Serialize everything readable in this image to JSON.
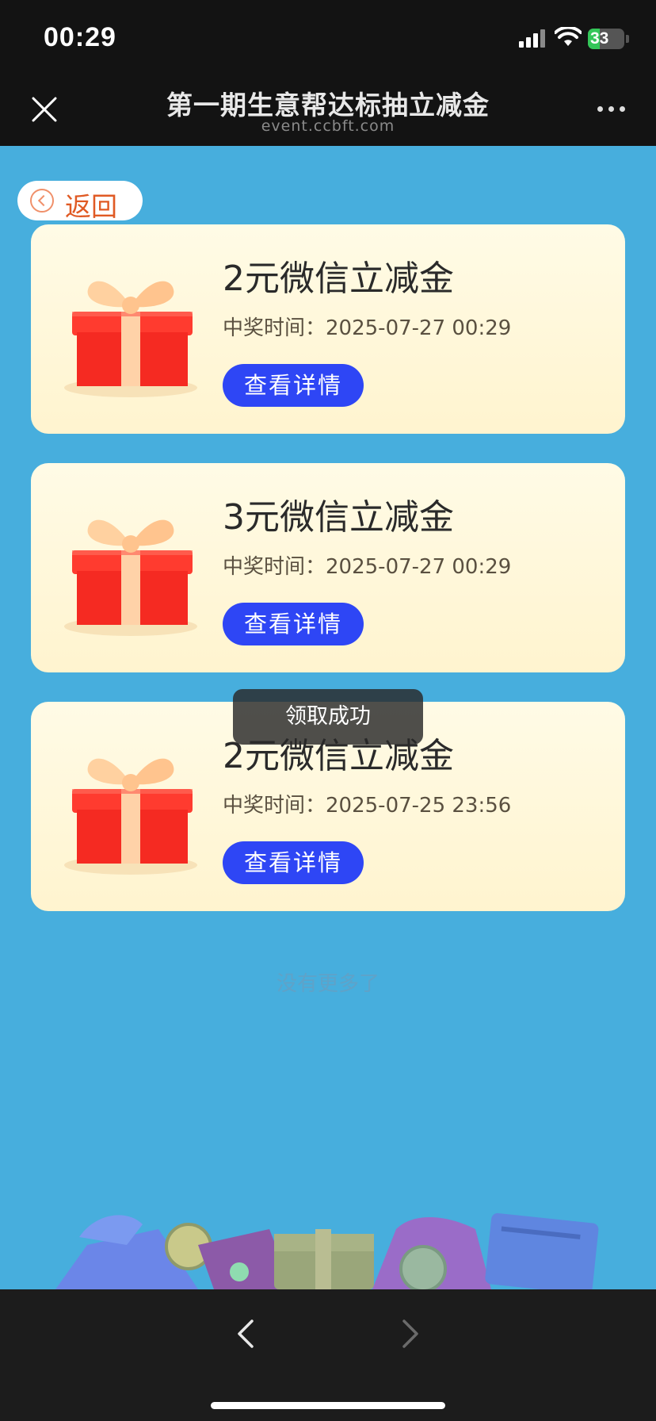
{
  "status_bar": {
    "time": "00:29",
    "battery": "33",
    "battery_level": 0.33
  },
  "title_bar": {
    "title": "第一期生意帮达标抽立减金",
    "url": "event.ccbft.com"
  },
  "back": {
    "label": "返回"
  },
  "prizes": [
    {
      "name": "2元微信立减金",
      "time_label": "中奖时间：",
      "time": "2025-07-27 00:29",
      "button": "查看详情"
    },
    {
      "name": "3元微信立减金",
      "time_label": "中奖时间：",
      "time": "2025-07-27 00:29",
      "button": "查看详情"
    },
    {
      "name": "2元微信立减金",
      "time_label": "中奖时间：",
      "time": "2025-07-25 23:56",
      "button": "查看详情"
    }
  ],
  "toast": {
    "text": "领取成功"
  },
  "list_end": {
    "text": "没有更多了"
  },
  "colors": {
    "page_bg": "#47aedd",
    "button": "#2e46f5",
    "back_label": "#e05a24",
    "bar": "#131313"
  },
  "icons": [
    "close-icon",
    "more-icon",
    "back-circle-icon",
    "gift-icon",
    "chevron-left-icon",
    "chevron-right-icon"
  ]
}
